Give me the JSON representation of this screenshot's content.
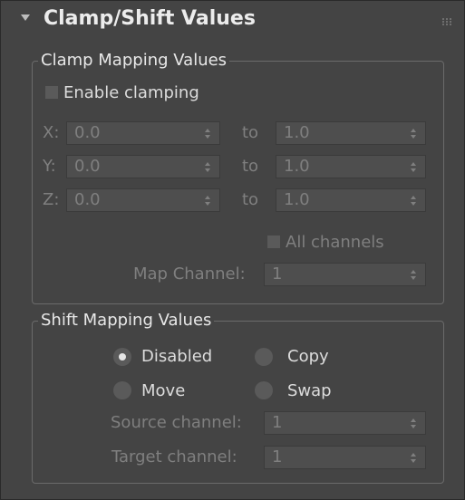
{
  "panel": {
    "title": "Clamp/Shift Values",
    "collapse_icon": "triangle-down-icon",
    "grip_icon": "grip-dots-icon"
  },
  "clamp": {
    "legend": "Clamp Mapping Values",
    "enable_label": "Enable clamping",
    "enable_checked": false,
    "to_label": "to",
    "rows": [
      {
        "axis": "X:",
        "from": "0.0",
        "to": "1.0"
      },
      {
        "axis": "Y:",
        "from": "0.0",
        "to": "1.0"
      },
      {
        "axis": "Z:",
        "from": "0.0",
        "to": "1.0"
      }
    ],
    "all_channels_label": "All channels",
    "all_channels_checked": false,
    "map_channel_label": "Map Channel:",
    "map_channel_value": "1"
  },
  "shift": {
    "legend": "Shift Mapping Values",
    "options": {
      "disabled": "Disabled",
      "copy": "Copy",
      "move": "Move",
      "swap": "Swap"
    },
    "selected": "Disabled",
    "source_label": "Source channel:",
    "source_value": "1",
    "target_label": "Target channel:",
    "target_value": "1"
  },
  "colors": {
    "background": "#444444",
    "text": "#dcdcdc",
    "disabled_text": "#7f7f7f",
    "field_bg": "#4e4e4e",
    "group_border": "#6b6b6b"
  }
}
